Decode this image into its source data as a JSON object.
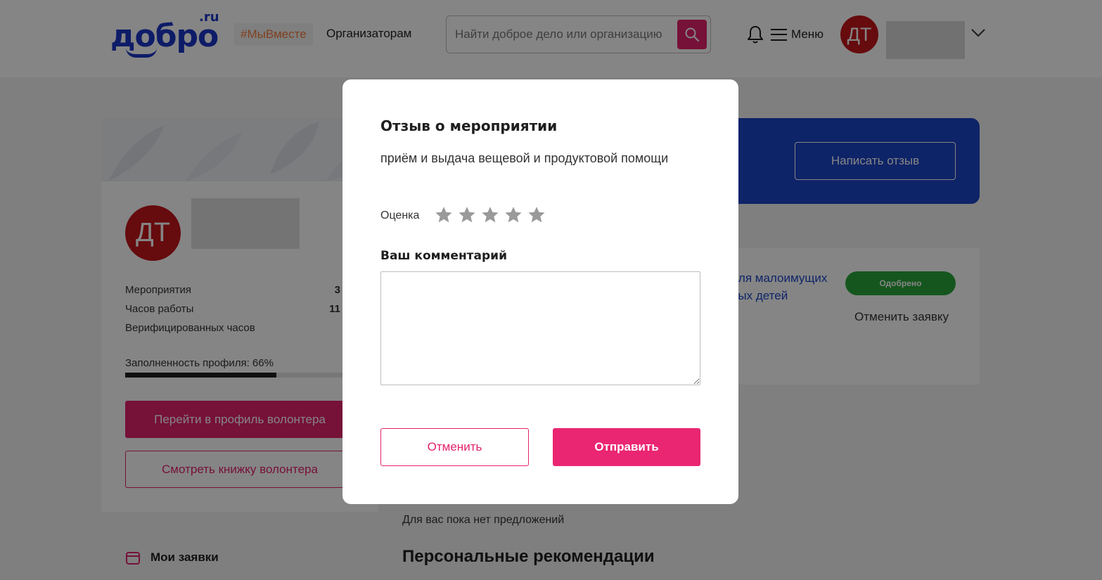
{
  "header": {
    "logo_text": "добро",
    "logo_suffix": ".ru",
    "tag": "#МыВместе",
    "organizers_link": "Организаторам",
    "search_placeholder": "Найти доброе дело или организацию",
    "menu_label": "Меню",
    "avatar_initials": "ДТ",
    "icons": [
      "search-icon",
      "bell-icon",
      "hamburger-icon",
      "chevron-down-icon"
    ]
  },
  "profile": {
    "avatar_initials": "ДТ",
    "stats": [
      {
        "label": "Мероприятия",
        "value": "3"
      },
      {
        "label": "Часов работы",
        "value": "11"
      },
      {
        "label": "Верифицированных часов",
        "value": ""
      }
    ],
    "completion_label": "Заполненность профиля: 66%",
    "completion_percent": 66,
    "go_profile_button": "Перейти в профиль волонтера",
    "view_book_button": "Смотреть книжку волонтера"
  },
  "sidebar": {
    "my_requests": "Мои заявки"
  },
  "main": {
    "write_review_button": "Написать отзыв",
    "application": {
      "title_line1": "для малоимущих",
      "title_line2": "ных детей",
      "status": "Одобрено",
      "cancel_link": "Отменить заявку"
    },
    "no_offers": "Для вас пока нет предложений",
    "recommendations_title": "Персональные рекомендации"
  },
  "modal": {
    "title": "Отзыв о мероприятии",
    "event_name": "приём и выдача вещевой и продуктовой помощи",
    "rating_label": "Оценка",
    "rating_max": 5,
    "rating_value": 0,
    "comment_label": "Ваш комментарий",
    "comment_value": "",
    "cancel_button": "Отменить",
    "submit_button": "Отправить"
  },
  "colors": {
    "brand_blue": "#1c36c8",
    "accent_pink": "#e3226c",
    "avatar_red": "#c4161c",
    "success_green": "#2aa63a",
    "star_gray": "#9a9a9a"
  }
}
